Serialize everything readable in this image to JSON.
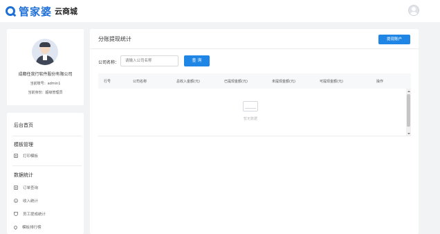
{
  "header": {
    "brand": "管家婆",
    "brand_sub": "云商城",
    "logo_icon": "q-logo-icon",
    "avatar_icon": "user-avatar-icon"
  },
  "profile": {
    "company": "成都任我行软件股份有限公司",
    "account": "当前账号：admin1",
    "role": "当前身份：超级管理员"
  },
  "sidebar": {
    "home": "后台首页",
    "groups": [
      {
        "label": "模板管理",
        "items": [
          {
            "label": "打印模板",
            "icon": "template-icon"
          }
        ]
      },
      {
        "label": "数据统计",
        "items": [
          {
            "label": "订单查询",
            "icon": "order-doc-icon"
          },
          {
            "label": "收入统计",
            "icon": "income-icon"
          },
          {
            "label": "员工提成统计",
            "icon": "commission-icon"
          },
          {
            "label": "模板排行榜",
            "icon": "ranking-icon"
          }
        ]
      }
    ]
  },
  "main": {
    "title": "分账提现统计",
    "withdraw_button": "提现账户",
    "filter": {
      "label": "公司名称：",
      "placeholder": "请输入公司名称",
      "query_button": "查 询"
    },
    "table": {
      "columns": [
        "行号",
        "公司名称",
        "总收入金额(元)",
        "已提现金额(元)",
        "未提现金额(元)",
        "可提现金额(元)",
        "操作"
      ],
      "empty_text": "暂无数据"
    }
  },
  "colors": {
    "accent": "#1f86e6",
    "brand": "#1f6fd8",
    "background": "#f2f3f5"
  }
}
